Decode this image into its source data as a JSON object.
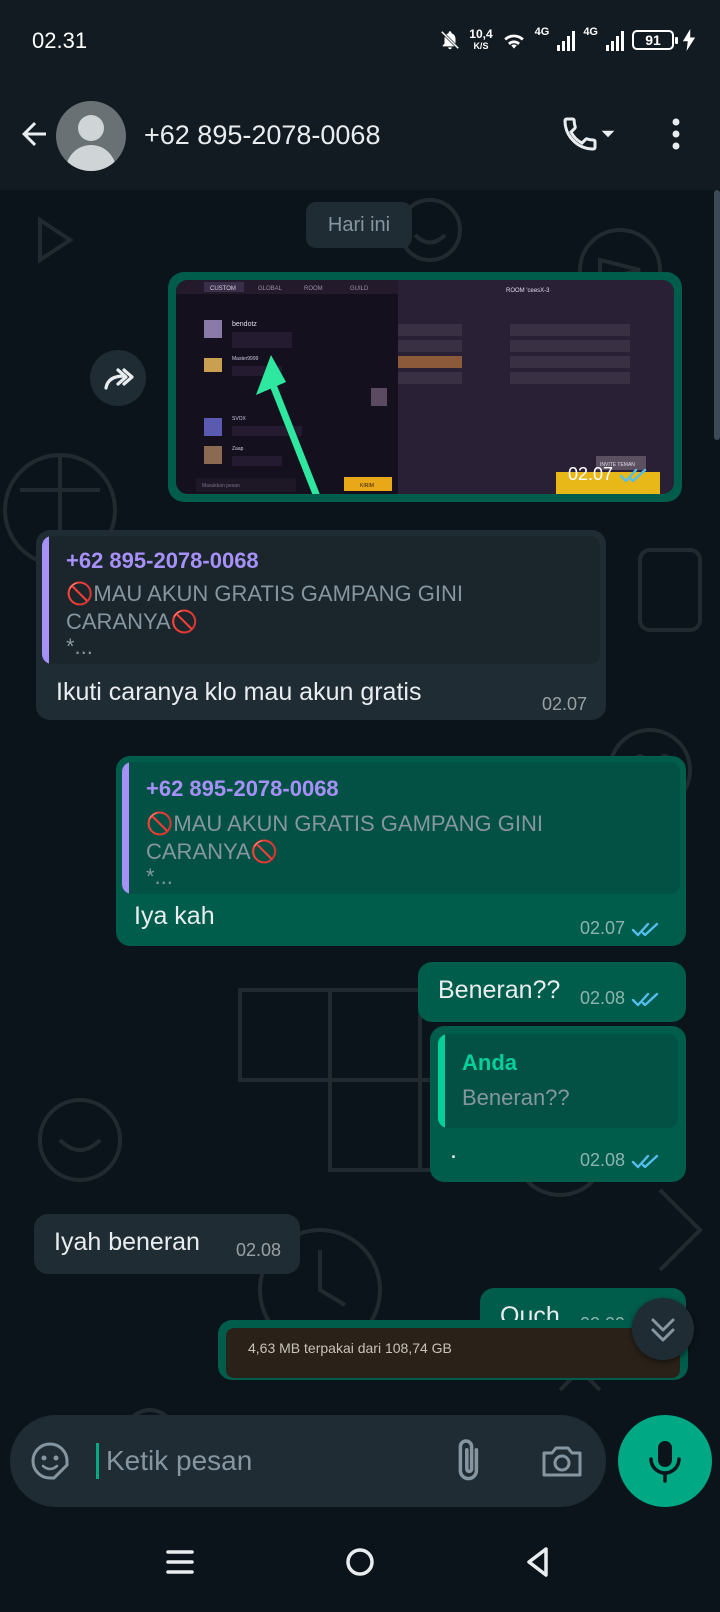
{
  "status_bar": {
    "time": "02.31",
    "net_speed": "10,4",
    "net_speed_unit": "K/S",
    "network_1": "4G",
    "network_2": "4G",
    "battery": "91"
  },
  "header": {
    "contact_name": "+62 895-2078-0068",
    "icons": [
      "back-arrow-icon",
      "avatar",
      "phone-icon",
      "more-vert-icon"
    ]
  },
  "chat": {
    "date_label": "Hari ini",
    "messages": [
      {
        "type": "image",
        "direction": "out",
        "time": "02.07",
        "status": "read",
        "image_texts": {
          "tab_custom": "CUSTOM",
          "tab_global": "GLOBAL",
          "tab_room": "ROOM",
          "tab_guild": "GUILD",
          "room_title": "ROOM 'ceesX-3",
          "player_1": "bendotz",
          "player_2": "Master9999",
          "player_3": "SVOX",
          "player_4": "Zaap",
          "message_placeholder": "Masukkan pesan",
          "send_button": "KIRIM",
          "invite_button": "INVITE TEMAN"
        }
      },
      {
        "type": "text_reply",
        "direction": "in",
        "quote_author": "+62 895-2078-0068",
        "quote_line_1": "🚫MAU AKUN GRATIS GAMPANG GINI",
        "quote_line_2": "CARANYA🚫",
        "quote_more": "*...",
        "text": "Ikuti caranya klo mau akun gratis",
        "time": "02.07"
      },
      {
        "type": "text_reply",
        "direction": "out",
        "quote_author": "+62 895-2078-0068",
        "quote_line_1": "🚫MAU AKUN GRATIS GAMPANG GINI",
        "quote_line_2": "CARANYA🚫",
        "quote_more": "*...",
        "text": "Iya kah",
        "time": "02.07",
        "status": "read"
      },
      {
        "type": "text",
        "direction": "out",
        "text": "Beneran??",
        "time": "02.08",
        "status": "read"
      },
      {
        "type": "text_reply",
        "direction": "out",
        "quote_author": "Anda",
        "quote_line_1": "Beneran??",
        "text": ".",
        "time": "02.08",
        "status": "read"
      },
      {
        "type": "text",
        "direction": "in",
        "text": "Iyah beneran",
        "time": "02.08"
      },
      {
        "type": "text",
        "direction": "out",
        "text": "Ouch",
        "time": "02.09",
        "status": "read"
      },
      {
        "type": "image_partial",
        "direction": "out",
        "caption_visible": "4,63 MB terpakai dari 108,74 GB"
      }
    ]
  },
  "composer": {
    "placeholder": "Ketik pesan",
    "value": ""
  },
  "colors": {
    "outgoing_bubble": "#005c4b",
    "incoming_bubble": "#1f2c34",
    "background": "#0b141a",
    "accent": "#00a884",
    "quote_bar_purple": "#a791f9",
    "quote_bar_green": "#06cf9c",
    "read_ticks": "#53bdeb"
  }
}
